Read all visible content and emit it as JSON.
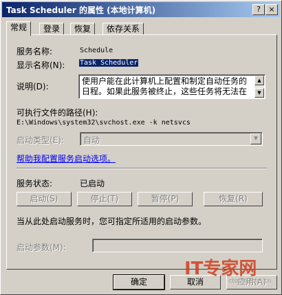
{
  "window": {
    "title": "Task Scheduler 的属性 (本地计算机)",
    "help_btn": "?",
    "close_btn": "×"
  },
  "tabs": [
    {
      "label": "常规"
    },
    {
      "label": "登录"
    },
    {
      "label": "恢复"
    },
    {
      "label": "依存关系"
    }
  ],
  "general": {
    "service_name_label": "服务名称:",
    "service_name": "Schedule",
    "display_name_label": "显示名称(N):",
    "display_name": "Task Scheduler",
    "description_label": "说明(D):",
    "description": "使用户能在此计算机上配置和制定自动任务的日程。如果此服务被终止，这些任务将无法在",
    "exe_path_label": "可执行文件的路径(H):",
    "exe_path": "E:\\Windows\\system32\\svchost.exe -k netsvcs",
    "startup_type_label": "启动类型(E):",
    "startup_type": "自动",
    "help_link": "帮助我配置服务启动选项。",
    "status_label": "服务状态:",
    "status_value": "已启动",
    "start_btn": "启动(S)",
    "stop_btn": "停止(T)",
    "pause_btn": "暂停(P)",
    "resume_btn": "恢复(R)",
    "hint": "当从此处启动服务时，您可指定所适用的启动参数。",
    "params_label": "启动参数(M):",
    "params_value": ""
  },
  "footer": {
    "ok": "确定",
    "cancel": "取消",
    "apply": "应用(A)"
  },
  "watermark": {
    "logo": "IT专家网",
    "url": "ctocio.com.cn"
  }
}
